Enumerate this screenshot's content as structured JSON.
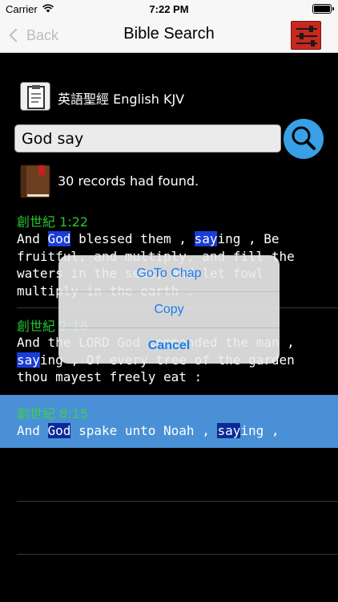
{
  "status_bar": {
    "carrier": "Carrier",
    "time": "7:22 PM"
  },
  "nav": {
    "back_label": "Back",
    "title": "Bible Search"
  },
  "version": {
    "label": "英語聖經 English KJV"
  },
  "search": {
    "value": "God say"
  },
  "records": {
    "text": "30 records had found."
  },
  "results": [
    {
      "ref": "創世紀 1:22",
      "segments": [
        {
          "t": "And ",
          "h": false
        },
        {
          "t": "God",
          "h": true
        },
        {
          "t": " blessed them , ",
          "h": false
        },
        {
          "t": "say",
          "h": true
        },
        {
          "t": "ing , Be fruitful, and multiply, and fill the waters in the seas, and let fowl multiply in the earth .",
          "h": false
        }
      ]
    },
    {
      "ref": "創世紀 2:16",
      "segments": [
        {
          "t": "And the LORD God commanded the man , ",
          "h": false
        },
        {
          "t": "say",
          "h": true
        },
        {
          "t": "ing , Of every tree of the garden thou mayest freely eat :",
          "h": false
        }
      ]
    },
    {
      "ref": "創世紀 8:15",
      "segments": [
        {
          "t": "And ",
          "h": false
        },
        {
          "t": "God",
          "h": true
        },
        {
          "t": " spake unto Noah , ",
          "h": false
        },
        {
          "t": "say",
          "h": true
        },
        {
          "t": "ing ,",
          "h": false
        }
      ]
    }
  ],
  "popup": {
    "goto_label": "GoTo Chap",
    "copy_label": "Copy",
    "cancel_label": "Cancel"
  }
}
